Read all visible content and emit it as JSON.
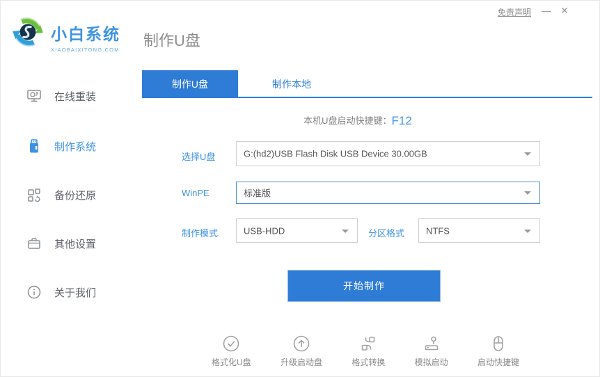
{
  "titlebar": {
    "disclaimer": "免责声明",
    "minimize_icon": "—",
    "close_icon": "✕"
  },
  "brand": {
    "name": "小白系统",
    "domain": "XIAOBAIXITONG.COM"
  },
  "header": {
    "page_title": "制作U盘"
  },
  "sidebar": {
    "items": [
      {
        "label": "在线重装",
        "icon": "monitor-reinstall-icon",
        "active": false
      },
      {
        "label": "制作系统",
        "icon": "usb-drive-icon",
        "active": true
      },
      {
        "label": "备份还原",
        "icon": "backup-restore-icon",
        "active": false
      },
      {
        "label": "其他设置",
        "icon": "briefcase-icon",
        "active": false
      },
      {
        "label": "关于我们",
        "icon": "info-icon",
        "active": false
      }
    ]
  },
  "tabs": [
    {
      "label": "制作U盘",
      "active": true
    },
    {
      "label": "制作本地",
      "active": false
    }
  ],
  "hotkey": {
    "label": "本机U盘启动快捷键：",
    "value": "F12"
  },
  "form": {
    "usb_select": {
      "label": "选择U盘",
      "value": "G:(hd2)USB Flash Disk USB Device 30.00GB"
    },
    "winpe": {
      "label": "WinPE",
      "value": "标准版"
    },
    "mode": {
      "label": "制作模式",
      "value": "USB-HDD"
    },
    "partition": {
      "label": "分区格式",
      "value": "NTFS"
    }
  },
  "actions": {
    "start_button": "开始制作"
  },
  "tools": [
    {
      "label": "格式化U盘",
      "icon": "check-circle-icon"
    },
    {
      "label": "升级启动盘",
      "icon": "arrow-up-circle-icon"
    },
    {
      "label": "格式转换",
      "icon": "format-convert-icon"
    },
    {
      "label": "模拟启动",
      "icon": "simulate-boot-icon"
    },
    {
      "label": "启动快捷键",
      "icon": "mouse-icon"
    }
  ],
  "colors": {
    "accent": "#2e7cd6",
    "label_blue": "#3e93e0",
    "active_border": "#4a90d9"
  }
}
